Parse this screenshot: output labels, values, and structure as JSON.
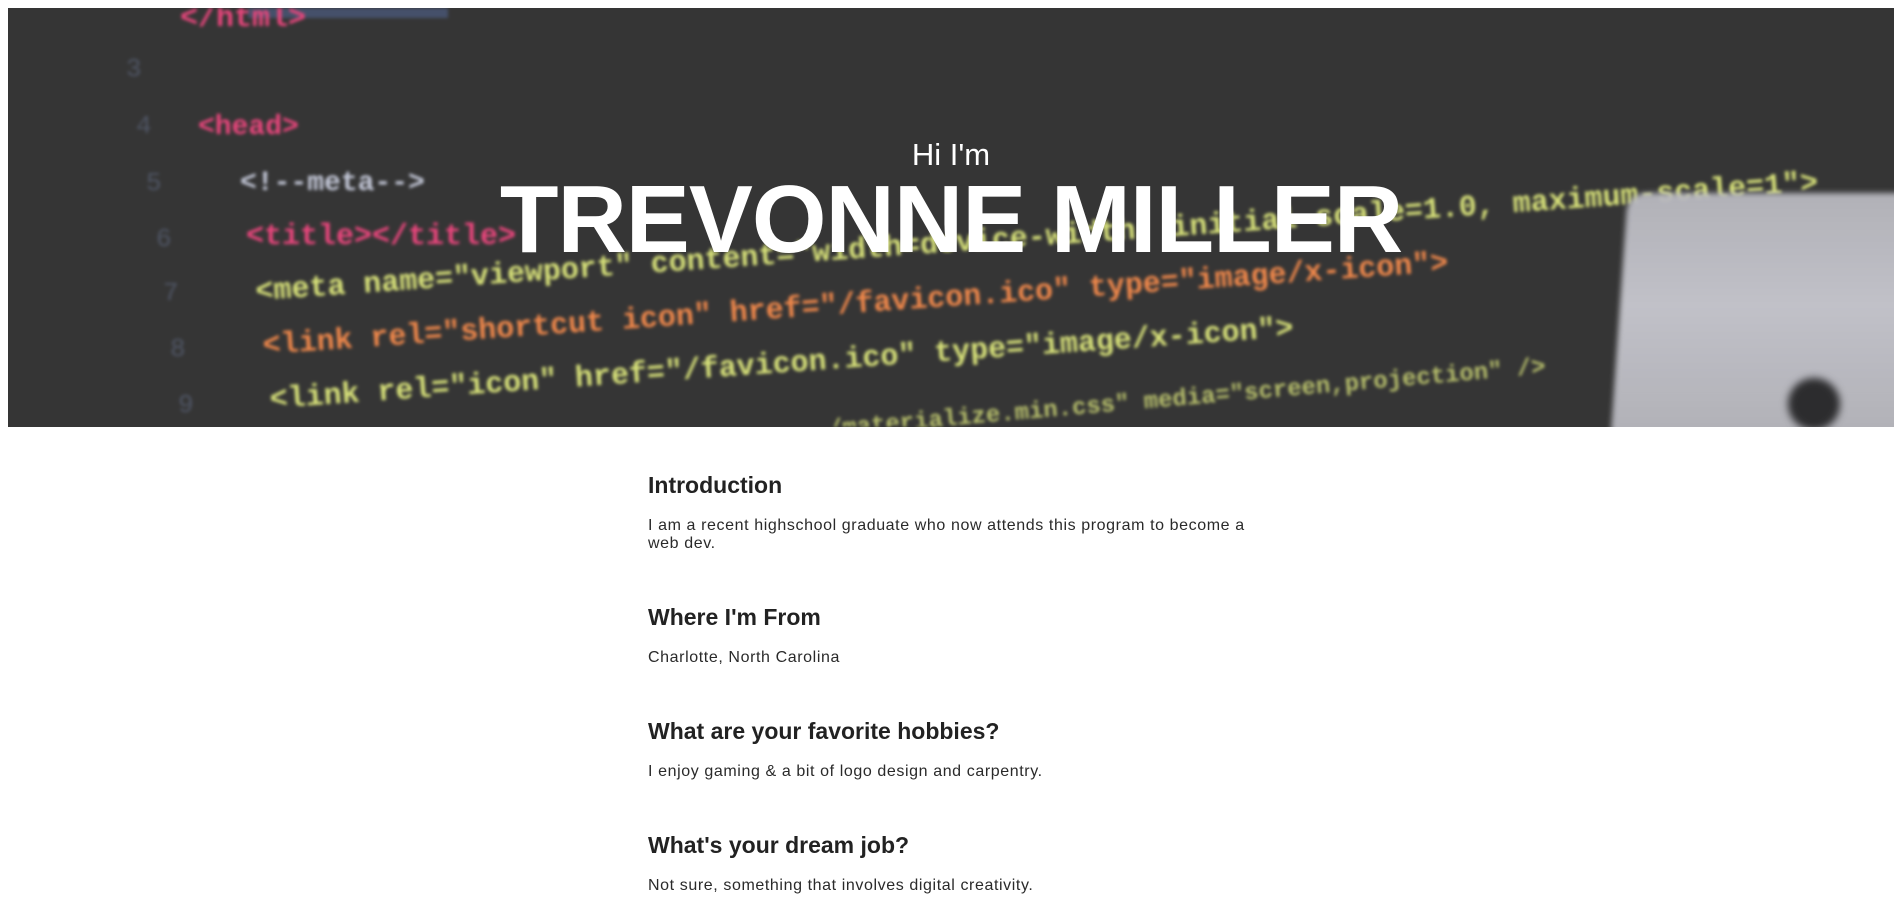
{
  "hero": {
    "greeting": "Hi I'm",
    "name": "TREVONNE MILLER",
    "background_code_lines": [
      "</html>",
      "<head>",
      "<!--meta-->",
      "<title></title>",
      "<meta name=\"viewport\" content=\"width=device-width, initial-scale=1.0, maximum-scale=1\">",
      "<link rel=\"shortcut icon\" href=\"/favicon.ico\" type=\"image/x-icon\">",
      "<link rel=\"icon\" href=\"/favicon.ico\" type=\"image/x-icon\">",
      "/materialize.min.css\" media=\"screen,projection\" />"
    ],
    "background_line_numbers": [
      "3",
      "4",
      "5",
      "6",
      "7",
      "8",
      "9"
    ],
    "colors": {
      "background": "#353535",
      "tag": "#e8467c",
      "attribute": "#f0884b",
      "string": "#d8e27a",
      "text": "#c4c8d8",
      "title_text": "#ffffff"
    }
  },
  "sections": [
    {
      "heading": "Introduction",
      "body": "I am a recent highschool graduate who now attends this program to become a web dev."
    },
    {
      "heading": "Where I'm From",
      "body": "Charlotte, North Carolina"
    },
    {
      "heading": "What are your favorite hobbies?",
      "body": "I enjoy gaming & a bit of logo design and carpentry."
    },
    {
      "heading": "What's your dream job?",
      "body": "Not sure, something that involves digital creativity."
    }
  ]
}
